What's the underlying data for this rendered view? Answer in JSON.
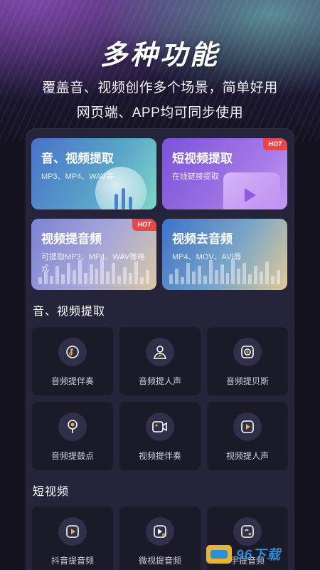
{
  "hero": {
    "title": "多种功能",
    "subtitle_line1": "覆盖音、视频创作多个场景，简单好用",
    "subtitle_line2": "网页端、APP均可同步使用"
  },
  "features": [
    {
      "title": "音、视频提取",
      "desc": "MP3、MP4、WAV等",
      "hot": false
    },
    {
      "title": "短视频提取",
      "desc": "在线链接提取",
      "hot": true,
      "badge": "HOT"
    },
    {
      "title": "视频提音频",
      "desc": "可提取MP3、MP4、WAV等格式",
      "hot": true,
      "badge": "HOT"
    },
    {
      "title": "视频去音频",
      "desc": "MP4、MOV、AVI等",
      "hot": false
    }
  ],
  "sections": [
    {
      "title": "音、视频提取",
      "tiles": [
        {
          "label": "音频提伴奏",
          "icon": "music-note-icon"
        },
        {
          "label": "音频提人声",
          "icon": "person-voice-icon"
        },
        {
          "label": "音频提贝斯",
          "icon": "speaker-icon"
        },
        {
          "label": "音频提鼓点",
          "icon": "drum-point-icon"
        },
        {
          "label": "视频提伴奏",
          "icon": "video-camera-icon"
        },
        {
          "label": "视频提人声",
          "icon": "video-play-icon"
        }
      ]
    },
    {
      "title": "短视频",
      "tiles": [
        {
          "label": "抖音提音频",
          "icon": "play-box-icon"
        },
        {
          "label": "微视提音频",
          "icon": "play-box-audio-icon"
        },
        {
          "label": "手提音频",
          "icon": "cut-link-icon"
        }
      ]
    }
  ],
  "watermark": {
    "text": "96下载"
  },
  "colors": {
    "background": "#14121f",
    "panel": "#26243a",
    "tile": "#1b1a28",
    "hot": "#e9464a"
  }
}
